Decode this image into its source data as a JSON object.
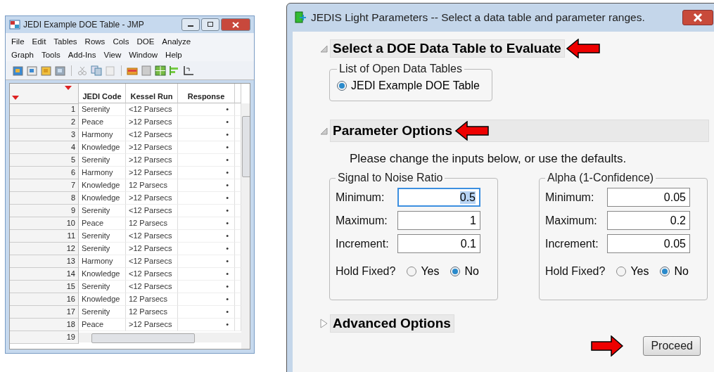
{
  "table_window": {
    "title": "JEDI Example DOE Table - JMP",
    "menu_rows": [
      [
        "File",
        "Edit",
        "Tables",
        "Rows",
        "Cols",
        "DOE",
        "Analyze"
      ],
      [
        "Graph",
        "Tools",
        "Add-Ins",
        "View",
        "Window",
        "Help"
      ]
    ],
    "table": {
      "columns": [
        "JEDI Code",
        "Kessel Run",
        "Response"
      ],
      "rows": [
        {
          "number": "1",
          "cells": [
            "Serenity",
            "<12 Parsecs",
            "•"
          ]
        },
        {
          "number": "2",
          "cells": [
            "Peace",
            ">12 Parsecs",
            "•"
          ]
        },
        {
          "number": "3",
          "cells": [
            "Harmony",
            "<12 Parsecs",
            "•"
          ]
        },
        {
          "number": "4",
          "cells": [
            "Knowledge",
            ">12 Parsecs",
            "•"
          ]
        },
        {
          "number": "5",
          "cells": [
            "Serenity",
            ">12 Parsecs",
            "•"
          ]
        },
        {
          "number": "6",
          "cells": [
            "Harmony",
            ">12 Parsecs",
            "•"
          ]
        },
        {
          "number": "7",
          "cells": [
            "Knowledge",
            "12 Parsecs",
            "•"
          ]
        },
        {
          "number": "8",
          "cells": [
            "Knowledge",
            ">12 Parsecs",
            "•"
          ]
        },
        {
          "number": "9",
          "cells": [
            "Serenity",
            "<12 Parsecs",
            "•"
          ]
        },
        {
          "number": "10",
          "cells": [
            "Peace",
            "12 Parsecs",
            "•"
          ]
        },
        {
          "number": "11",
          "cells": [
            "Serenity",
            "<12 Parsecs",
            "•"
          ]
        },
        {
          "number": "12",
          "cells": [
            "Serenity",
            ">12 Parsecs",
            "•"
          ]
        },
        {
          "number": "13",
          "cells": [
            "Harmony",
            "<12 Parsecs",
            "•"
          ]
        },
        {
          "number": "14",
          "cells": [
            "Knowledge",
            "<12 Parsecs",
            "•"
          ]
        },
        {
          "number": "15",
          "cells": [
            "Serenity",
            "<12 Parsecs",
            "•"
          ]
        },
        {
          "number": "16",
          "cells": [
            "Knowledge",
            "12 Parsecs",
            "•"
          ]
        },
        {
          "number": "17",
          "cells": [
            "Serenity",
            "12 Parsecs",
            "•"
          ]
        },
        {
          "number": "18",
          "cells": [
            "Peace",
            ">12 Parsecs",
            "•"
          ]
        }
      ],
      "partial_row_number": "19"
    }
  },
  "dialog": {
    "title": "JEDIS Light Parameters -- Select a data table and parameter ranges.",
    "table_section": {
      "title": "Select a DOE Data Table to Evaluate",
      "expanded": true,
      "group_title": "List of Open Data Tables",
      "options": [
        {
          "label": "JEDI Example DOE Table",
          "selected": true
        }
      ]
    },
    "parameter_section": {
      "title": "Parameter Options",
      "expanded": true,
      "instructions": "Please change the inputs below, or use the defaults.",
      "groups": [
        {
          "title": "Signal to Noise Ratio",
          "fields": [
            {
              "label": "Minimum:",
              "value": "0.5",
              "focused": true
            },
            {
              "label": "Maximum:",
              "value": "1",
              "focused": false
            },
            {
              "label": "Increment:",
              "value": "0.1",
              "focused": false
            }
          ],
          "hold_label": "Hold Fixed?",
          "hold_options": [
            {
              "label": "Yes",
              "selected": false
            },
            {
              "label": "No",
              "selected": true
            }
          ]
        },
        {
          "title": "Alpha (1-Confidence)",
          "fields": [
            {
              "label": "Minimum:",
              "value": "0.05",
              "focused": false
            },
            {
              "label": "Maximum:",
              "value": "0.2",
              "focused": false
            },
            {
              "label": "Increment:",
              "value": "0.05",
              "focused": false
            }
          ],
          "hold_label": "Hold Fixed?",
          "hold_options": [
            {
              "label": "Yes",
              "selected": false
            },
            {
              "label": "No",
              "selected": true
            }
          ]
        }
      ]
    },
    "advanced_section": {
      "title": "Advanced Options",
      "expanded": false
    },
    "proceed_button": "Proceed"
  }
}
